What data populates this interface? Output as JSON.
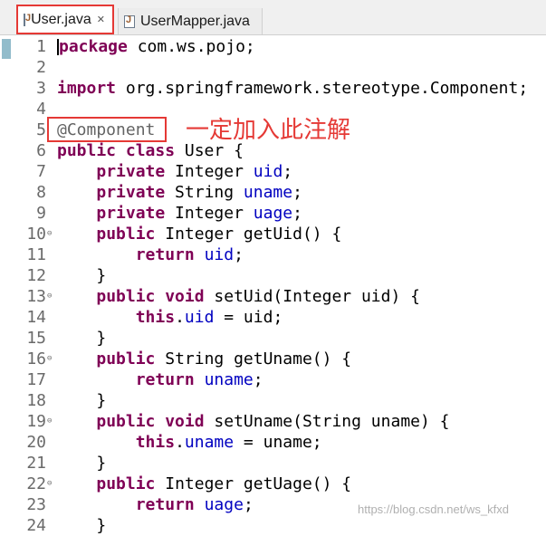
{
  "tabs": [
    {
      "label": "User.java",
      "active": true,
      "closable": true
    },
    {
      "label": "UserMapper.java",
      "active": false
    }
  ],
  "annotation_note": "一定加入此注解",
  "colors": {
    "highlight": "#e53935",
    "keyword": "#7f0055",
    "field": "#0000c0",
    "annotation": "#646464"
  },
  "watermark": "https://blog.csdn.net/ws_kfxd",
  "code": {
    "lines": [
      {
        "n": "1",
        "parts": [
          [
            "kw",
            "package"
          ],
          [
            "t",
            " com.ws.pojo;"
          ]
        ]
      },
      {
        "n": "2",
        "parts": []
      },
      {
        "n": "3",
        "parts": [
          [
            "kw",
            "import"
          ],
          [
            "t",
            " org.springframework.stereotype.Component;"
          ]
        ]
      },
      {
        "n": "4",
        "parts": []
      },
      {
        "n": "5",
        "parts": [
          [
            "anno",
            "@Component"
          ]
        ]
      },
      {
        "n": "6",
        "parts": [
          [
            "kw",
            "public class"
          ],
          [
            "t",
            " User {"
          ]
        ]
      },
      {
        "n": "7",
        "parts": [
          [
            "t",
            "    "
          ],
          [
            "kw",
            "private"
          ],
          [
            "t",
            " Integer "
          ],
          [
            "field",
            "uid"
          ],
          [
            "t",
            ";"
          ]
        ]
      },
      {
        "n": "8",
        "parts": [
          [
            "t",
            "    "
          ],
          [
            "kw",
            "private"
          ],
          [
            "t",
            " String "
          ],
          [
            "field",
            "uname"
          ],
          [
            "t",
            ";"
          ]
        ]
      },
      {
        "n": "9",
        "parts": [
          [
            "t",
            "    "
          ],
          [
            "kw",
            "private"
          ],
          [
            "t",
            " Integer "
          ],
          [
            "field",
            "uage"
          ],
          [
            "t",
            ";"
          ]
        ]
      },
      {
        "n": "10",
        "fold": true,
        "parts": [
          [
            "t",
            "    "
          ],
          [
            "kw",
            "public"
          ],
          [
            "t",
            " Integer getUid() {"
          ]
        ]
      },
      {
        "n": "11",
        "parts": [
          [
            "t",
            "        "
          ],
          [
            "kw",
            "return"
          ],
          [
            "t",
            " "
          ],
          [
            "field",
            "uid"
          ],
          [
            "t",
            ";"
          ]
        ]
      },
      {
        "n": "12",
        "parts": [
          [
            "t",
            "    }"
          ]
        ]
      },
      {
        "n": "13",
        "fold": true,
        "parts": [
          [
            "t",
            "    "
          ],
          [
            "kw",
            "public void"
          ],
          [
            "t",
            " setUid(Integer uid) {"
          ]
        ]
      },
      {
        "n": "14",
        "parts": [
          [
            "t",
            "        "
          ],
          [
            "kw",
            "this"
          ],
          [
            "t",
            "."
          ],
          [
            "field",
            "uid"
          ],
          [
            "t",
            " = uid;"
          ]
        ]
      },
      {
        "n": "15",
        "parts": [
          [
            "t",
            "    }"
          ]
        ]
      },
      {
        "n": "16",
        "fold": true,
        "parts": [
          [
            "t",
            "    "
          ],
          [
            "kw",
            "public"
          ],
          [
            "t",
            " String getUname() {"
          ]
        ]
      },
      {
        "n": "17",
        "parts": [
          [
            "t",
            "        "
          ],
          [
            "kw",
            "return"
          ],
          [
            "t",
            " "
          ],
          [
            "field",
            "uname"
          ],
          [
            "t",
            ";"
          ]
        ]
      },
      {
        "n": "18",
        "parts": [
          [
            "t",
            "    }"
          ]
        ]
      },
      {
        "n": "19",
        "fold": true,
        "parts": [
          [
            "t",
            "    "
          ],
          [
            "kw",
            "public void"
          ],
          [
            "t",
            " setUname(String uname) {"
          ]
        ]
      },
      {
        "n": "20",
        "parts": [
          [
            "t",
            "        "
          ],
          [
            "kw",
            "this"
          ],
          [
            "t",
            "."
          ],
          [
            "field",
            "uname"
          ],
          [
            "t",
            " = uname;"
          ]
        ]
      },
      {
        "n": "21",
        "parts": [
          [
            "t",
            "    }"
          ]
        ]
      },
      {
        "n": "22",
        "fold": true,
        "parts": [
          [
            "t",
            "    "
          ],
          [
            "kw",
            "public"
          ],
          [
            "t",
            " Integer getUage() {"
          ]
        ]
      },
      {
        "n": "23",
        "parts": [
          [
            "t",
            "        "
          ],
          [
            "kw",
            "return"
          ],
          [
            "t",
            " "
          ],
          [
            "field",
            "uage"
          ],
          [
            "t",
            ";"
          ]
        ]
      },
      {
        "n": "24",
        "parts": [
          [
            "t",
            "    }"
          ]
        ]
      }
    ]
  }
}
